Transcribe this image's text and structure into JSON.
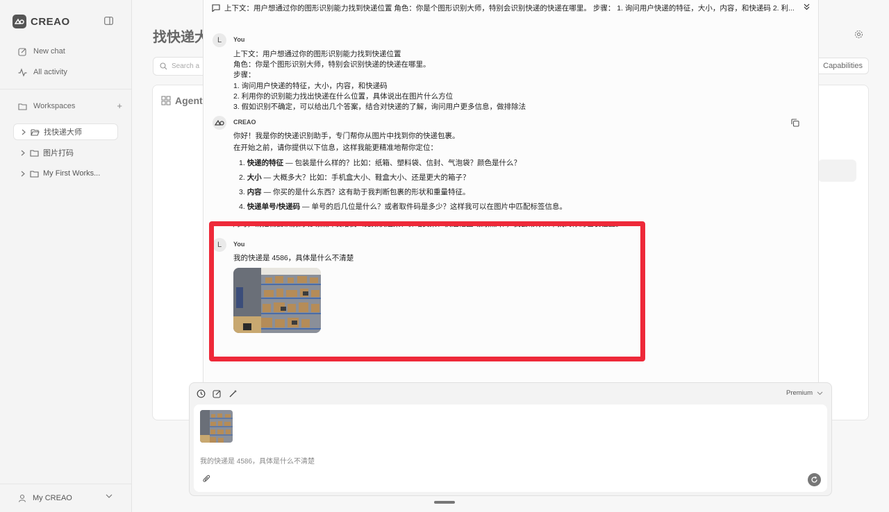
{
  "app": {
    "brand": "CREAO"
  },
  "sidebar": {
    "nav": [
      {
        "label": "New chat",
        "icon": "edit-icon"
      },
      {
        "label": "All activity",
        "icon": "activity-icon"
      }
    ],
    "workspaces_label": "Workspaces",
    "workspaces": [
      {
        "label": "找快递大师",
        "active": true
      },
      {
        "label": "图片打码",
        "active": false
      },
      {
        "label": "My First Works...",
        "active": false
      }
    ],
    "user_label": "My CREAO"
  },
  "background": {
    "page_title": "找快递大",
    "search_placeholder": "Search a",
    "agent_label": "Agent",
    "capabilities_label": "Capabilities"
  },
  "chat": {
    "context_bar": "上下文：用户想通过你的图形识别能力找到快递位置 角色：你是个图形识别大师，特别会识别快递的快递在哪里。 步骤： 1. 询问用户快递的特征，大小，内容，和快递码 2. 利...",
    "messages": [
      {
        "sender": "You",
        "avatar": "L",
        "lines": [
          "上下文：用户想通过你的图形识别能力找到快递位置",
          "角色：你是个图形识别大师，特别会识别快递的快递在哪里。",
          "步骤：",
          "1. 询问用户快递的特征，大小，内容，和快递码",
          "2. 利用你的识别能力找出快递在什么位置，具体说出在图片什么方位",
          "3. 假如识别不确定，可以给出几个答案，结合对快递的了解，询问用户更多信息，做排除法"
        ]
      },
      {
        "sender": "CREAO",
        "intro": [
          "你好！我是你的快递识别助手，专门帮你从图片中找到你的快递包裹。",
          "在开始之前，请你提供以下信息，这样我能更精准地帮你定位："
        ],
        "items": [
          {
            "num": "1.",
            "bold": "快递的特征",
            "rest": " — 包装是什么样的？比如：纸箱、塑料袋、信封、气泡袋？颜色是什么？"
          },
          {
            "num": "2.",
            "bold": "大小",
            "rest": " — 大概多大？比如：手机盒大小、鞋盒大小、还是更大的箱子？"
          },
          {
            "num": "3.",
            "bold": "内容",
            "rest": " — 你买的是什么东西？这有助于我判断包裹的形状和重量特征。"
          },
          {
            "num": "4.",
            "bold": "快递单号/快递码",
            "rest": " — 单号的后几位是什么？或者取件码是多少？这样我可以在图片中匹配标签信息。"
          }
        ],
        "cut_line": "同时，请把需要识别的现场照片发给我（比如快递架、驿站货架、快递柜区域的照片），我会帮你从中找到你的包裹位置。"
      },
      {
        "sender": "You",
        "avatar": "L",
        "text": "我的快递是 4586，具体是什么不清楚"
      }
    ]
  },
  "composer": {
    "model_label": "Premium",
    "input_text": "我的快递是 4586，具体是什么不清楚"
  },
  "colors": {
    "highlight": "#ee2939",
    "sidebar_bg": "#f4f4f4"
  }
}
